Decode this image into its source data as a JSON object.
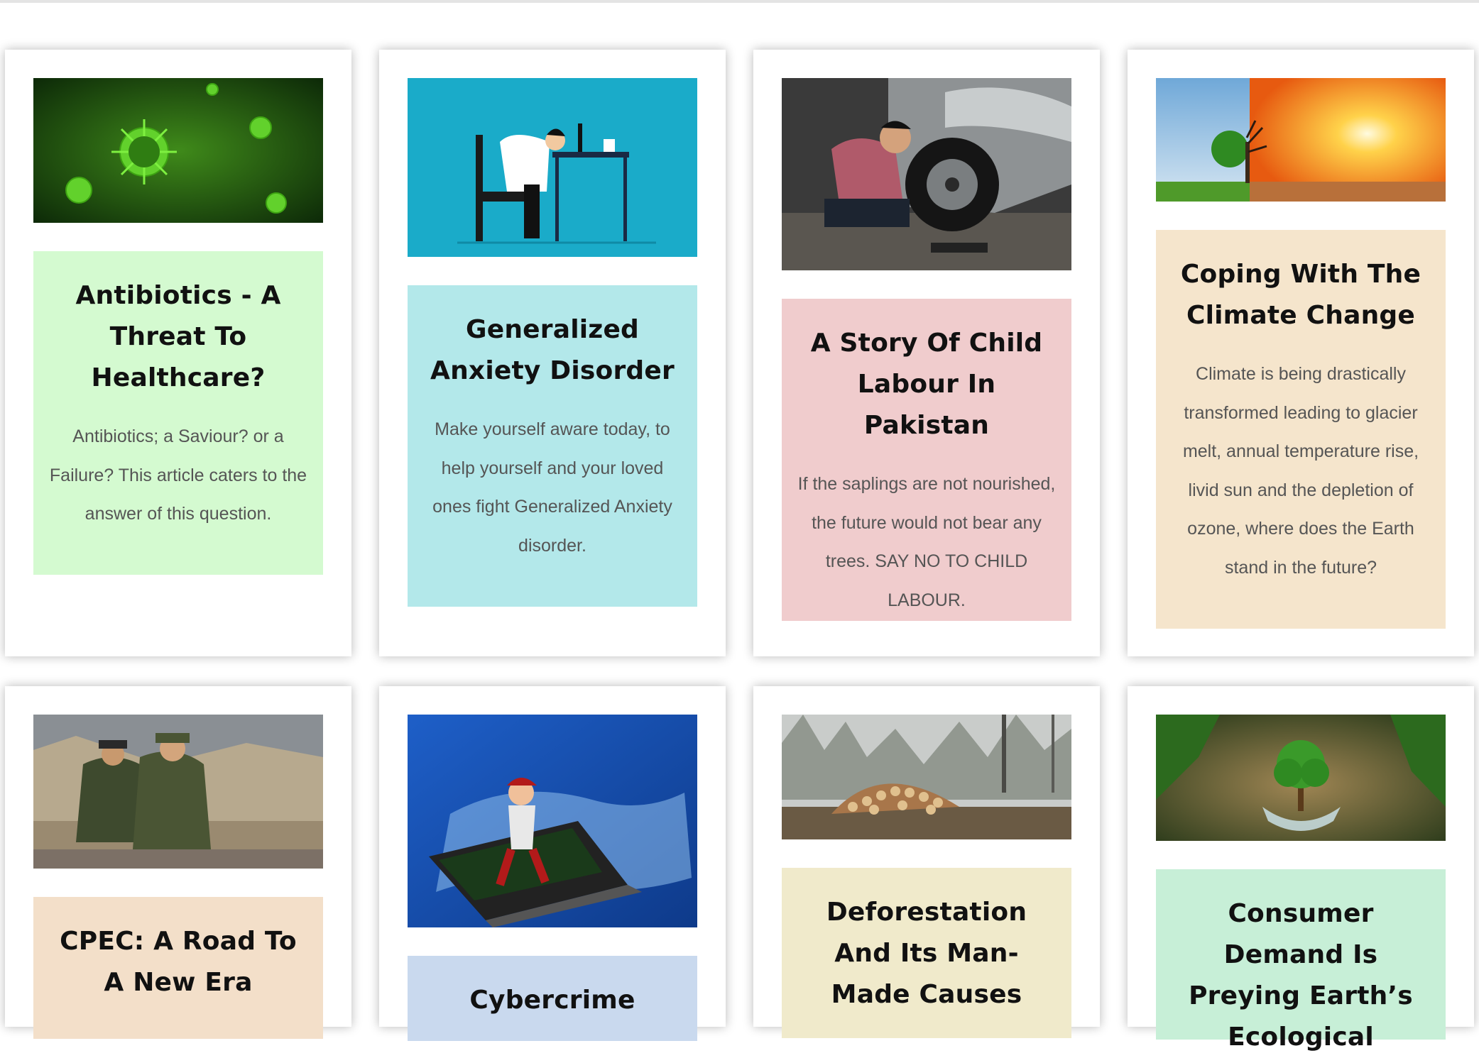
{
  "articles": [
    {
      "title": "Antibiotics - A Threat To Healthcare?",
      "excerpt": "Antibiotics; a Saviour? or a Failure? This article caters to the answer of this question.",
      "image": "virus-image",
      "box_color": "#d4fad0"
    },
    {
      "title": "Generalized Anxiety Disorder",
      "excerpt": "Make yourself aware today, to help yourself and your loved ones fight Generalized Anxiety disorder.",
      "image": "tired-worker-image",
      "box_color": "#b3e8ea"
    },
    {
      "title": "A Story Of Child Labour In Pakistan",
      "excerpt": "If the saplings are not nourished, the future would not bear any trees. SAY NO TO CHILD LABOUR.",
      "image": "child-labour-image",
      "box_color": "#f0cccd"
    },
    {
      "title": "Coping With The Climate Change",
      "excerpt": "Climate is being drastically transformed leading to glacier melt, annual temperature rise, livid sun and the depletion of ozone, where does the Earth stand in the future?",
      "image": "climate-image",
      "box_color": "#f5e5cc"
    },
    {
      "title": "CPEC: A Road To A New Era",
      "excerpt": "",
      "image": "soldiers-image",
      "box_color": "#f3dfc9"
    },
    {
      "title": "Cybercrime",
      "excerpt": "",
      "image": "cybercrime-image",
      "box_color": "#c9d9ee"
    },
    {
      "title": "Deforestation And Its Man-Made Causes",
      "excerpt": "",
      "image": "logs-image",
      "box_color": "#f0eacb"
    },
    {
      "title": "Consumer Demand Is Preying Earth’s Ecological",
      "excerpt": "",
      "image": "tree-globe-image",
      "box_color": "#c7efd7"
    }
  ]
}
